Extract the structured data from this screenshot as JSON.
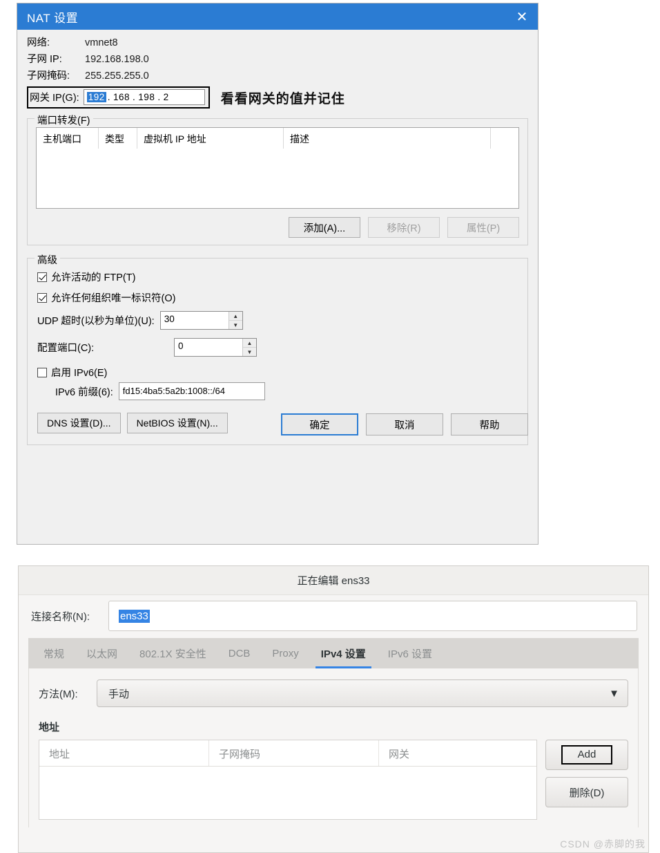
{
  "nat_dialog": {
    "title": "NAT 设置",
    "close_icon": "close-icon",
    "network_label": "网络:",
    "network_value": "vmnet8",
    "subnet_ip_label": "子网 IP:",
    "subnet_ip_value": "192.168.198.0",
    "subnet_mask_label": "子网掩码:",
    "subnet_mask_value": "255.255.255.0",
    "gateway_label": "网关 IP(G):",
    "gateway_octet1": "192",
    "gateway_octet2": "168",
    "gateway_octet3": "198",
    "gateway_octet4": "2",
    "gateway_note": "看看网关的值并记住",
    "port_forward": {
      "group_title": "端口转发(F)",
      "columns": [
        "主机端口",
        "类型",
        "虚拟机 IP 地址",
        "描述",
        ""
      ],
      "rows": [],
      "add_button": "添加(A)...",
      "remove_button": "移除(R)",
      "properties_button": "属性(P)"
    },
    "advanced": {
      "group_title": "高级",
      "allow_ftp_label": "允许活动的 FTP(T)",
      "allow_ftp_checked": true,
      "allow_any_oui_label": "允许任何组织唯一标识符(O)",
      "allow_any_oui_checked": true,
      "udp_timeout_label": "UDP 超时(以秒为单位)(U):",
      "udp_timeout_value": "30",
      "config_port_label": "配置端口(C):",
      "config_port_value": "0",
      "enable_ipv6_label": "启用 IPv6(E)",
      "enable_ipv6_checked": false,
      "ipv6_prefix_label": "IPv6 前缀(6):",
      "ipv6_prefix_value": "fd15:4ba5:5a2b:1008::/64",
      "dns_settings_button": "DNS 设置(D)...",
      "netbios_settings_button": "NetBIOS 设置(N)..."
    },
    "footer": {
      "ok_button": "确定",
      "cancel_button": "取消",
      "help_button": "帮助"
    }
  },
  "connection_editor": {
    "title": "正在编辑 ens33",
    "conn_name_label": "连接名称(N):",
    "conn_name_value": "ens33",
    "tabs": [
      {
        "label": "常规",
        "active": false
      },
      {
        "label": "以太网",
        "active": false
      },
      {
        "label": "802.1X 安全性",
        "active": false
      },
      {
        "label": "DCB",
        "active": false
      },
      {
        "label": "Proxy",
        "active": false
      },
      {
        "label": "IPv4 设置",
        "active": true
      },
      {
        "label": "IPv6 设置",
        "active": false
      }
    ],
    "method_label": "方法(M):",
    "method_value": "手动",
    "dropdown_icon": "chevron-down-icon",
    "addresses_label": "地址",
    "addr_columns": [
      "地址",
      "子网掩码",
      "网关"
    ],
    "addr_rows": [],
    "add_button": "Add",
    "delete_button": "删除(D)"
  },
  "watermark": "CSDN @赤脚的我",
  "colors": {
    "nat_titlebar": "#2b7cd3",
    "selection_blue": "#3584e4",
    "tab_accent": "#3584e4"
  }
}
